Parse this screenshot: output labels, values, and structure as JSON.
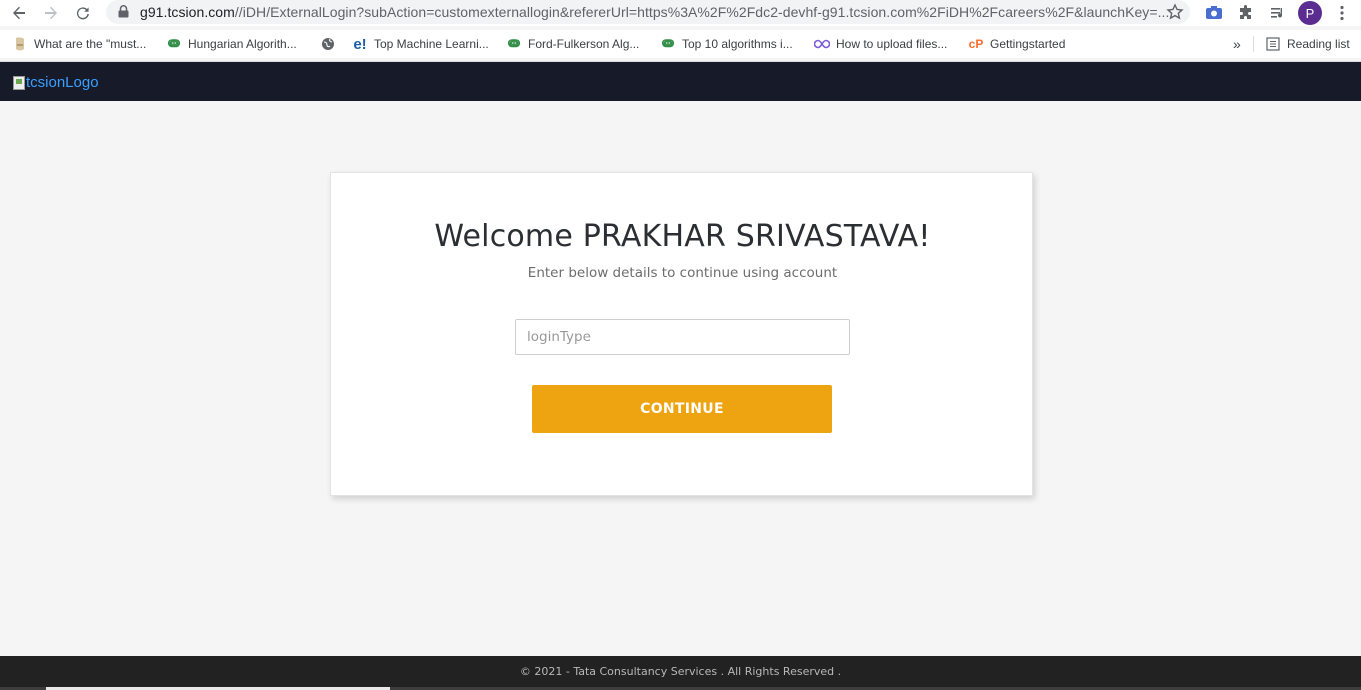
{
  "browser": {
    "url_host": "g91.tcsion.com",
    "url_rest": "//iDH/ExternalLogin?subAction=customexternallogin&refererUrl=https%3A%2F%2Fdc2-devhf-g91.tcsion.com%2FiDH%2Fcareers%2F&launchKey=...",
    "profile_initial": "P",
    "icons": [
      "back-icon",
      "forward-icon",
      "reload-icon",
      "lock-icon",
      "star-icon",
      "camera-icon",
      "puzzle-icon",
      "media-icon",
      "menu-icon"
    ]
  },
  "bookmarks": {
    "items": [
      {
        "label": "What are the \"must...",
        "icon": "bookmark-favicon"
      },
      {
        "label": "Hungarian Algorith...",
        "icon": "gfg-icon"
      },
      {
        "label": "",
        "icon": "globe-icon"
      },
      {
        "label": "Top Machine Learni...",
        "icon": "e-icon"
      },
      {
        "label": "Ford-Fulkerson Alg...",
        "icon": "gfg-icon"
      },
      {
        "label": "Top 10 algorithms i...",
        "icon": "gfg-icon"
      },
      {
        "label": "How to upload files...",
        "icon": "infinity-icon"
      },
      {
        "label": "Gettingstarted",
        "icon": "cpanel-icon"
      }
    ],
    "overflow": "»",
    "reading_list": "Reading list"
  },
  "header": {
    "logo_alt": "tcsionLogo"
  },
  "card": {
    "welcome": "Welcome PRAKHAR SRIVASTAVA!",
    "subtitle": "Enter below details to continue using account",
    "input_placeholder": "loginType",
    "input_value": "",
    "continue_label": "CONTINUE"
  },
  "footer": {
    "text": "© 2021 - Tata Consultancy Services . All Rights Reserved ."
  },
  "colors": {
    "header_bg": "#161a29",
    "accent": "#eda410",
    "footer_bg": "#222222",
    "logo_link": "#3aa0ff"
  }
}
